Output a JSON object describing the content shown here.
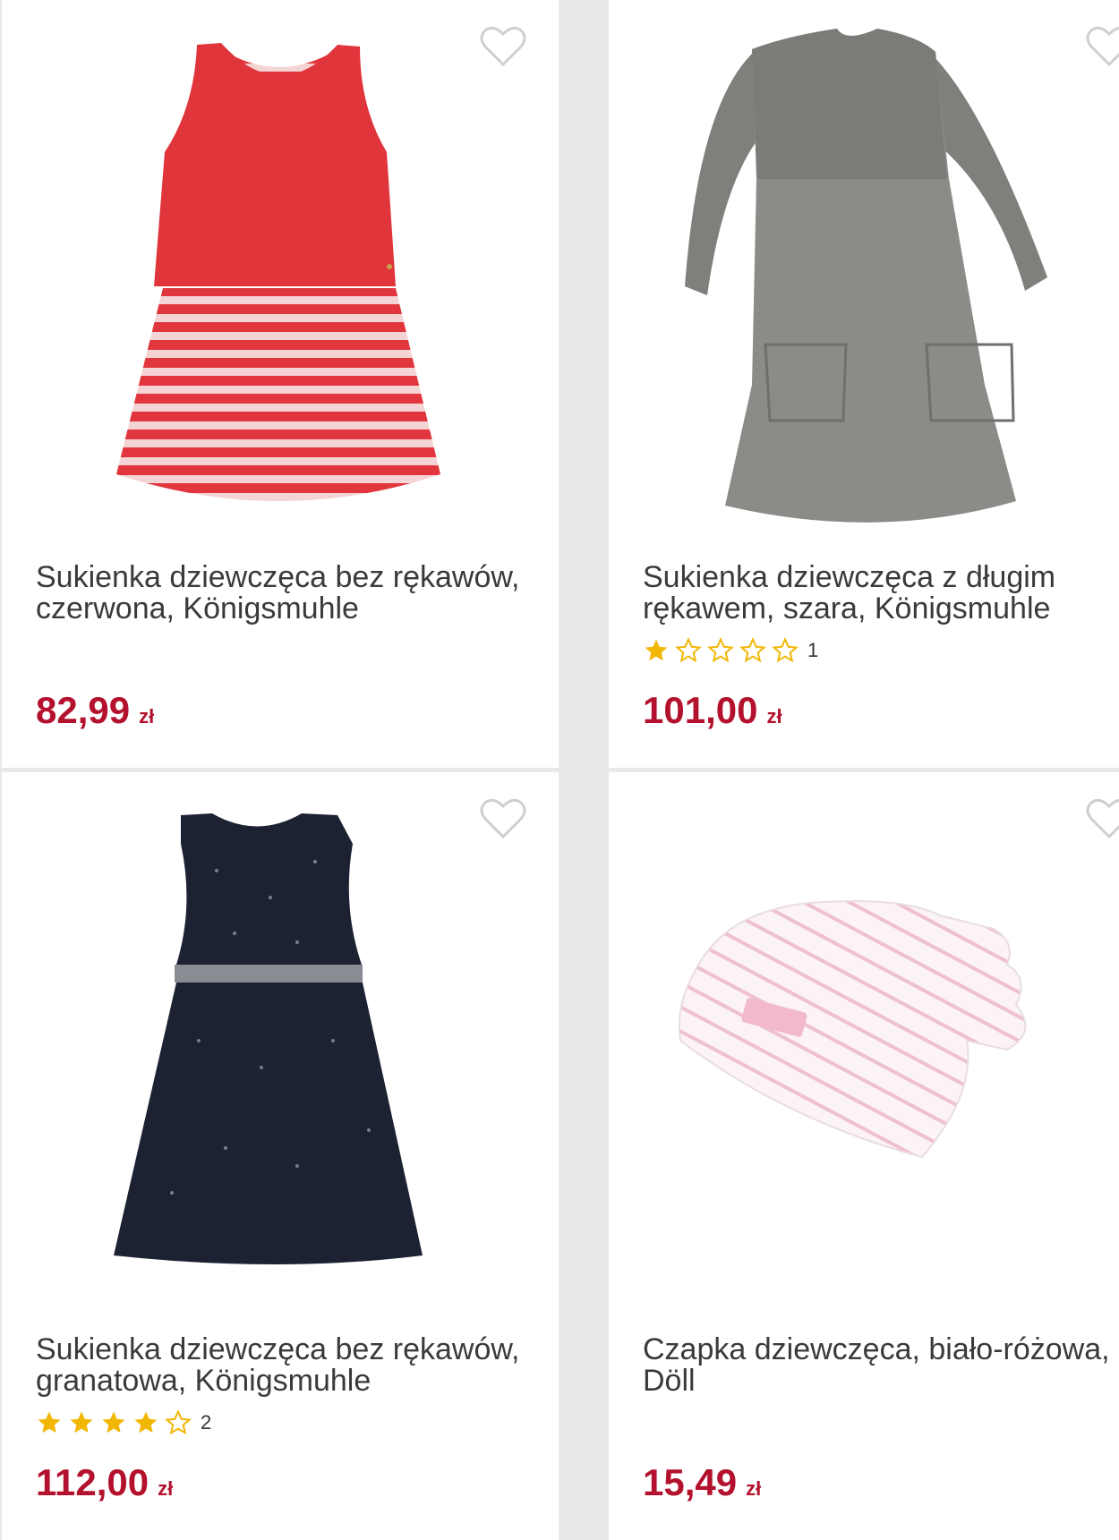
{
  "products": [
    {
      "title": "Sukienka dziewczęca bez rękawów, czerwona, Königsmuhle",
      "price": "82,99",
      "currency": "zł",
      "image": "red-striped-dress",
      "rating": null,
      "rating_count": ""
    },
    {
      "title": "Sukienka dziewczęca z długim rękawem, szara, Königsmuhle",
      "price": "101,00",
      "currency": "zł",
      "image": "grey-knit-dress",
      "rating": 1,
      "rating_count": "1"
    },
    {
      "title": "Sukienka dziewczęca bez rękawów, granatowa, Königsmuhle",
      "price": "112,00",
      "currency": "zł",
      "image": "navy-tulle-dress",
      "rating": 4,
      "rating_count": "2"
    },
    {
      "title": "Czapka dziewczęca, biało-różowa, Döll",
      "price": "15,49",
      "currency": "zł",
      "image": "pink-striped-hat",
      "rating": null,
      "rating_count": ""
    }
  ],
  "colors": {
    "price": "#b3112d",
    "star": "#f2b705",
    "heart": "#cfcfcf"
  },
  "icons": {
    "favorite": "heart-outline-icon",
    "rating": "star-icon"
  }
}
